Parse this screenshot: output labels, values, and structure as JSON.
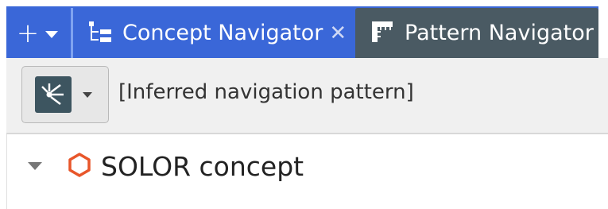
{
  "tabbar": {
    "add_menu_icon": "plus-icon",
    "tabs": [
      {
        "label": "Concept Navigator",
        "icon": "hierarchy-icon",
        "active": true,
        "close_glyph": "✕"
      },
      {
        "label": "Pattern Navigator",
        "icon": "ruler-icon",
        "active": false
      }
    ],
    "accent_color": "#3a67d8",
    "inactive_color": "#4a5a63"
  },
  "toolbar": {
    "view_icon": "inferred-navigation-icon",
    "navigation_pattern_label": "[Inferred navigation pattern]"
  },
  "tree": {
    "items": [
      {
        "label": "SOLOR concept",
        "icon": "hexagon-icon",
        "icon_color": "#e8562a",
        "expanded": true
      }
    ]
  }
}
